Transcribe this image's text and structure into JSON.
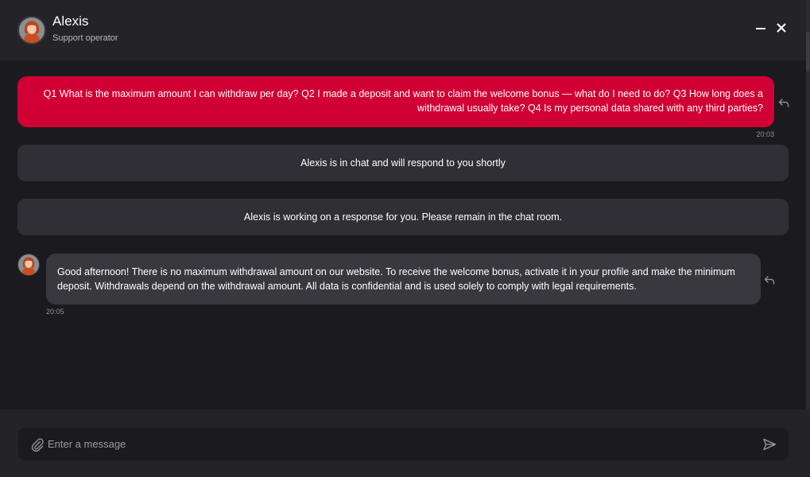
{
  "header": {
    "agent_name": "Alexis",
    "agent_role": "Support operator",
    "icons": {
      "minimize": "minimize-icon",
      "close": "close-icon"
    }
  },
  "messages": {
    "user": {
      "text": "Q1 What is the maximum amount I can withdraw per day? Q2 I made a deposit and want to claim the welcome bonus — what do I need to do? Q3 How long does a withdrawal usually take? Q4 Is my personal data shared with any third parties?",
      "time": "20:03"
    },
    "system": [
      {
        "text": "Alexis is in chat and will respond to you shortly"
      },
      {
        "text": "Alexis is working on a response for you. Please remain in the chat room."
      }
    ],
    "agent": {
      "text": "Good afternoon! There is no maximum withdrawal amount on our website. To receive the welcome bonus, activate it in your profile and make the minimum deposit. Withdrawals depend on the withdrawal amount. All data is confidential and is used solely to comply with legal requirements.",
      "time": "20:05"
    }
  },
  "composer": {
    "placeholder": "Enter a message",
    "icons": {
      "attach": "paperclip-icon",
      "send": "send-icon"
    }
  },
  "colors": {
    "accent": "#d10034",
    "background": "#1b1b1f",
    "header": "#232328",
    "system_bubble": "#2f2f35",
    "agent_bubble": "#38383e"
  }
}
